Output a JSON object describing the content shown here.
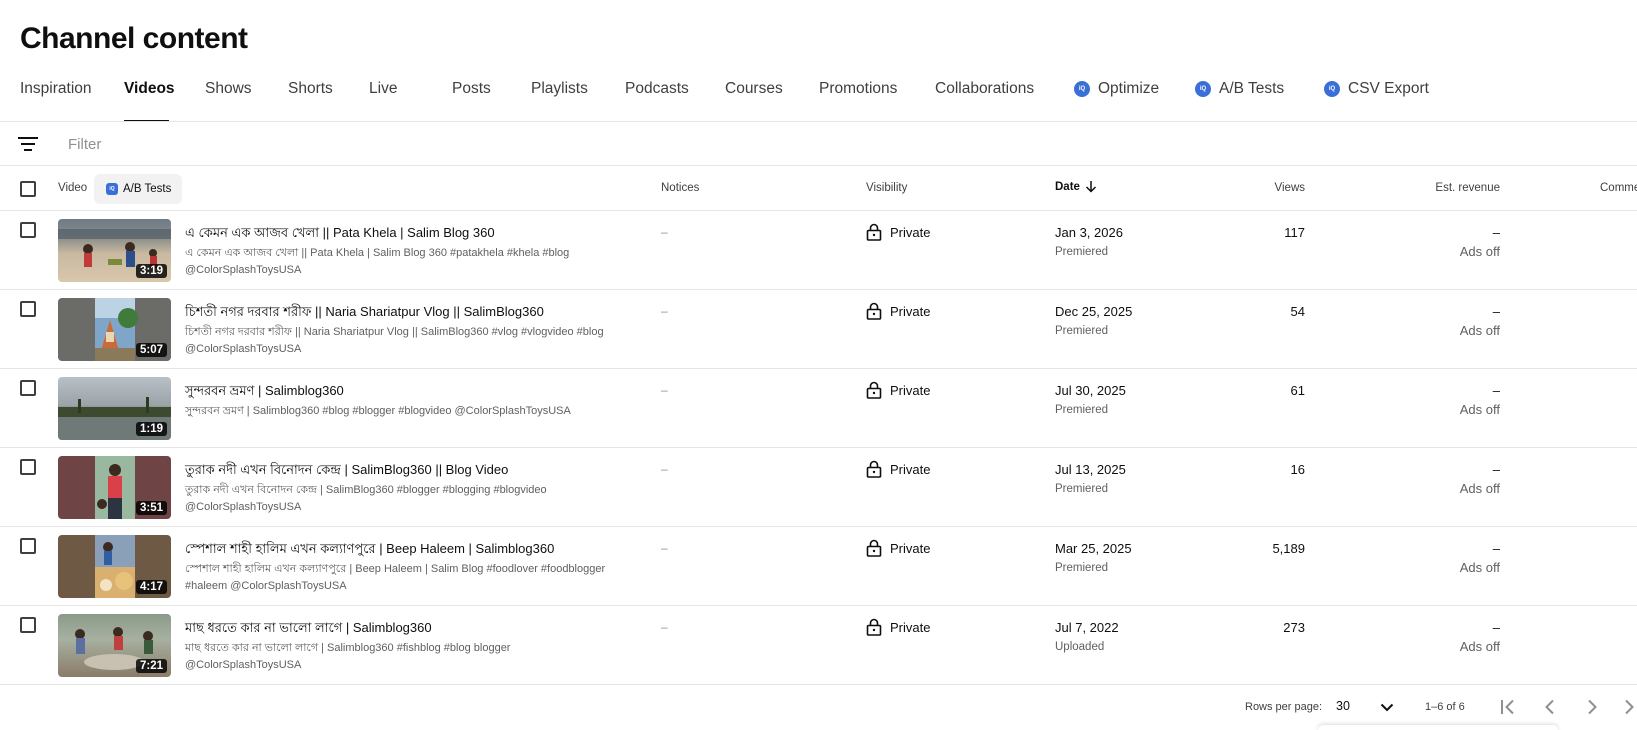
{
  "page": {
    "title": "Channel content"
  },
  "tabs": [
    {
      "label": "Inspiration"
    },
    {
      "label": "Videos"
    },
    {
      "label": "Shows"
    },
    {
      "label": "Shorts"
    },
    {
      "label": "Live"
    },
    {
      "label": "Posts"
    },
    {
      "label": "Playlists"
    },
    {
      "label": "Podcasts"
    },
    {
      "label": "Courses"
    },
    {
      "label": "Promotions"
    },
    {
      "label": "Collaborations"
    },
    {
      "label": "Optimize",
      "badge": "iQ"
    },
    {
      "label": "A/B Tests",
      "badge": "iQ"
    },
    {
      "label": "CSV Export",
      "badge": "iQ"
    }
  ],
  "active_tab": "Videos",
  "filter": {
    "placeholder": "Filter",
    "icon": "filter-lines-icon"
  },
  "columns": {
    "video": "Video",
    "ab_tests": "A/B Tests",
    "ab_badge": "iQ",
    "notices": "Notices",
    "visibility": "Visibility",
    "date": "Date",
    "views": "Views",
    "revenue": "Est. revenue",
    "comments": "Comme"
  },
  "rows": [
    {
      "title": "এ কেমন এক আজব খেলা || Pata Khela | Salim Blog 360",
      "desc1": "এ কেমন এক আজব খেলা || Pata Khela | Salim Blog 360 #patakhela #khela #blog",
      "desc2": "@ColorSplashToysUSA",
      "duration": "3:19",
      "notice": "–",
      "visibility": "Private",
      "date": "Jan 3, 2026",
      "date_type": "Premiered",
      "views": "117",
      "revenue": "–",
      "revenue_note": "Ads off"
    },
    {
      "title": "চিশতী নগর দরবার শরীফ || Naria Shariatpur Vlog || SalimBlog360",
      "desc1": "চিশতী নগর দরবার শরীফ || Naria Shariatpur Vlog || SalimBlog360 #vlog #vlogvideo #blog",
      "desc2": "@ColorSplashToysUSA",
      "duration": "5:07",
      "notice": "–",
      "visibility": "Private",
      "date": "Dec 25, 2025",
      "date_type": "Premiered",
      "views": "54",
      "revenue": "–",
      "revenue_note": "Ads off"
    },
    {
      "title": "সুন্দরবন ভ্রমণ | Salimblog360",
      "desc1": "সুন্দরবন ভ্রমণ | Salimblog360 #blog #blogger #blogvideo @ColorSplashToysUSA",
      "desc2": "",
      "duration": "1:19",
      "notice": "–",
      "visibility": "Private",
      "date": "Jul 30, 2025",
      "date_type": "Premiered",
      "views": "61",
      "revenue": "–",
      "revenue_note": "Ads off"
    },
    {
      "title": "তুরাক নদী এখন বিনোদন কেন্দ্র | SalimBlog360 || Blog Video",
      "desc1": "তুরাক নদী এখন বিনোদন কেন্দ্র | SalimBlog360 #blogger #blogging #blogvideo",
      "desc2": "@ColorSplashToysUSA",
      "duration": "3:51",
      "notice": "–",
      "visibility": "Private",
      "date": "Jul 13, 2025",
      "date_type": "Premiered",
      "views": "16",
      "revenue": "–",
      "revenue_note": "Ads off"
    },
    {
      "title": "স্পেশাল শাহী হালিম এখন কল্যাণপুরে | Beep Haleem | Salimblog360",
      "desc1": "স্পেশাল শাহী হালিম এখন কল্যাণপুরে | Beep Haleem | Salim Blog #foodlover #foodblogger",
      "desc2": "#haleem @ColorSplashToysUSA",
      "duration": "4:17",
      "notice": "–",
      "visibility": "Private",
      "date": "Mar 25, 2025",
      "date_type": "Premiered",
      "views": "5,189",
      "revenue": "–",
      "revenue_note": "Ads off"
    },
    {
      "title": "মাছ ধরতে কার না ভালো লাগে | Salimblog360",
      "desc1": "মাছ ধরতে কার না ভালো লাগে | Salimblog360 #fishblog #blog blogger",
      "desc2": "@ColorSplashToysUSA",
      "duration": "7:21",
      "notice": "–",
      "visibility": "Private",
      "date": "Jul 7, 2022",
      "date_type": "Uploaded",
      "views": "273",
      "revenue": "–",
      "revenue_note": "Ads off"
    }
  ],
  "footer": {
    "rows_per_page_label": "Rows per page:",
    "rows_per_page": "30",
    "range": "1–6 of 6"
  },
  "colors": {
    "accent": "#0f0f0f",
    "badge": "#3b6fd8",
    "divider": "#e5e5e5",
    "muted": "#606060"
  }
}
